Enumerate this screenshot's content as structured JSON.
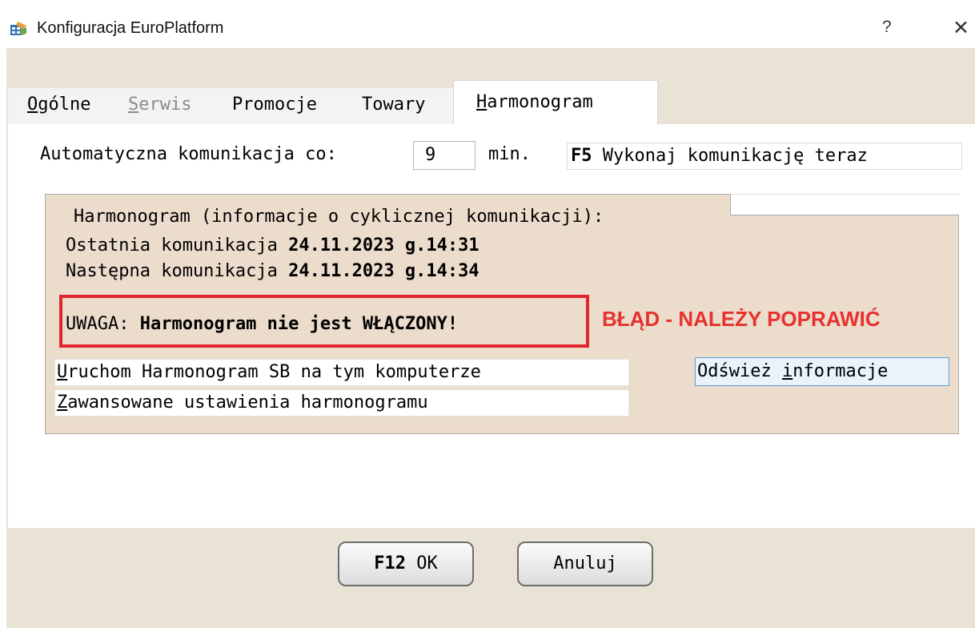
{
  "window": {
    "title": "Konfiguracja EuroPlatform",
    "help_glyph": "?",
    "close_glyph": "✕",
    "icon": "app-icon"
  },
  "tabs": [
    {
      "label": "Ogólne",
      "hotkey": "O",
      "rest": "gólne",
      "state": "normal"
    },
    {
      "label": "Serwis",
      "hotkey": "S",
      "rest": "erwis",
      "state": "disabled"
    },
    {
      "label": "Promocje",
      "state": "normal"
    },
    {
      "label": "Towary",
      "state": "normal"
    },
    {
      "label": "Harmonogram",
      "hotkey": "H",
      "rest": "armonogram",
      "state": "active"
    }
  ],
  "auto": {
    "label": "Automatyczna komunikacja co:",
    "interval_value": "9",
    "unit": "min.",
    "comm_key": "F5",
    "comm_text": "Wykonaj komunikację teraz"
  },
  "schedule": {
    "group_title": "Harmonogram (informacje o cyklicznej komunikacji):",
    "last_label": "Ostatnia komunikacja",
    "last_value": "24.11.2023 g.14:31",
    "next_label": "Następna komunikacja",
    "next_value": "24.11.2023 g.14:34",
    "warning_prefix": "UWAGA:",
    "warning_text": "Harmonogram nie jest WŁĄCZONY!",
    "error_note": "BŁĄD - NALEŻY POPRAWIĆ",
    "run_hotkey": "U",
    "run_rest": "ruchom Harmonogram SB na tym komputerze",
    "adv_hotkey": "Z",
    "adv_rest": "awansowane ustawienia harmonogramu",
    "refresh_a": "Odśwież ",
    "refresh_hotkey": "i",
    "refresh_b": "nformacje"
  },
  "footer": {
    "ok_key": "F12",
    "ok_label": "OK",
    "cancel_label": "Anuluj"
  },
  "colors": {
    "dialog_bg": "#e9e3d5",
    "group_bg": "#ecdccc",
    "warning_border": "#e1252c",
    "error_text": "#e6322e",
    "focus_border": "#5e9fd6"
  }
}
